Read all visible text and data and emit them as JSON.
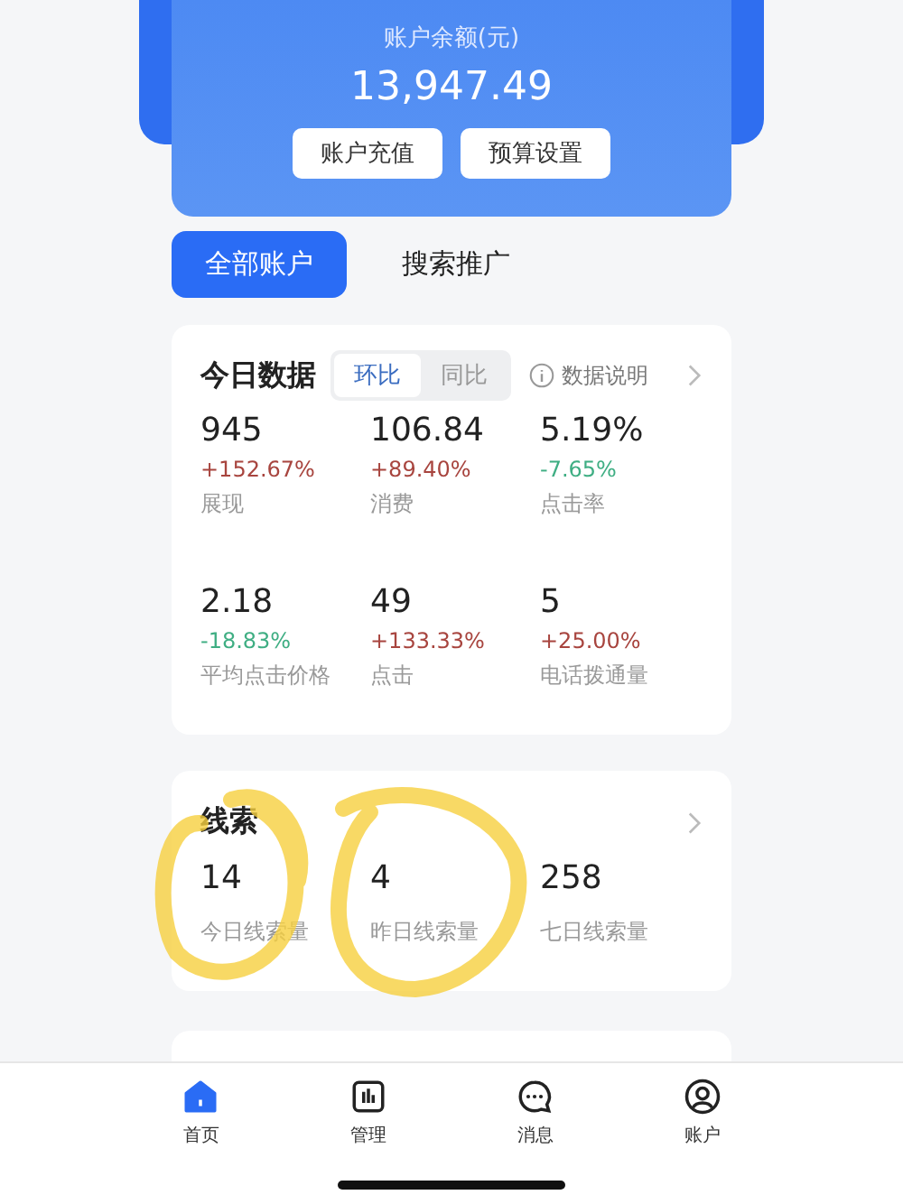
{
  "balance": {
    "label": "账户余额(元)",
    "amount": "13,947.49",
    "buttons": [
      "账户充值",
      "预算设置"
    ]
  },
  "account_tabs": [
    {
      "label": "全部账户",
      "selected": true
    },
    {
      "label": "搜索推广",
      "selected": false
    }
  ],
  "today": {
    "title": "今日数据",
    "toggle": [
      {
        "label": "环比",
        "selected": true
      },
      {
        "label": "同比",
        "selected": false
      }
    ],
    "info": "数据说明",
    "metrics": [
      {
        "value": "945",
        "change": "+152.67%",
        "color": "#a8453f",
        "label": "展现"
      },
      {
        "value": "106.84",
        "change": "+89.40%",
        "color": "#a8453f",
        "label": "消费"
      },
      {
        "value": "5.19%",
        "change": "-7.65%",
        "color": "#3fae83",
        "label": "点击率"
      },
      {
        "value": "2.18",
        "change": "-18.83%",
        "color": "#3fae83",
        "label": "平均点击价格"
      },
      {
        "value": "49",
        "change": "+133.33%",
        "color": "#a8453f",
        "label": "点击"
      },
      {
        "value": "5",
        "change": "+25.00%",
        "color": "#a8453f",
        "label": "电话拨通量"
      }
    ]
  },
  "leads": {
    "title": "线索",
    "stats": [
      {
        "value": "14",
        "label": "今日线索量"
      },
      {
        "value": "4",
        "label": "昨日线索量"
      },
      {
        "value": "258",
        "label": "七日线索量"
      }
    ]
  },
  "tab_bar": [
    {
      "label": "首页",
      "selected": true
    },
    {
      "label": "管理",
      "selected": false
    },
    {
      "label": "消息",
      "selected": false
    },
    {
      "label": "账户",
      "selected": false
    }
  ]
}
